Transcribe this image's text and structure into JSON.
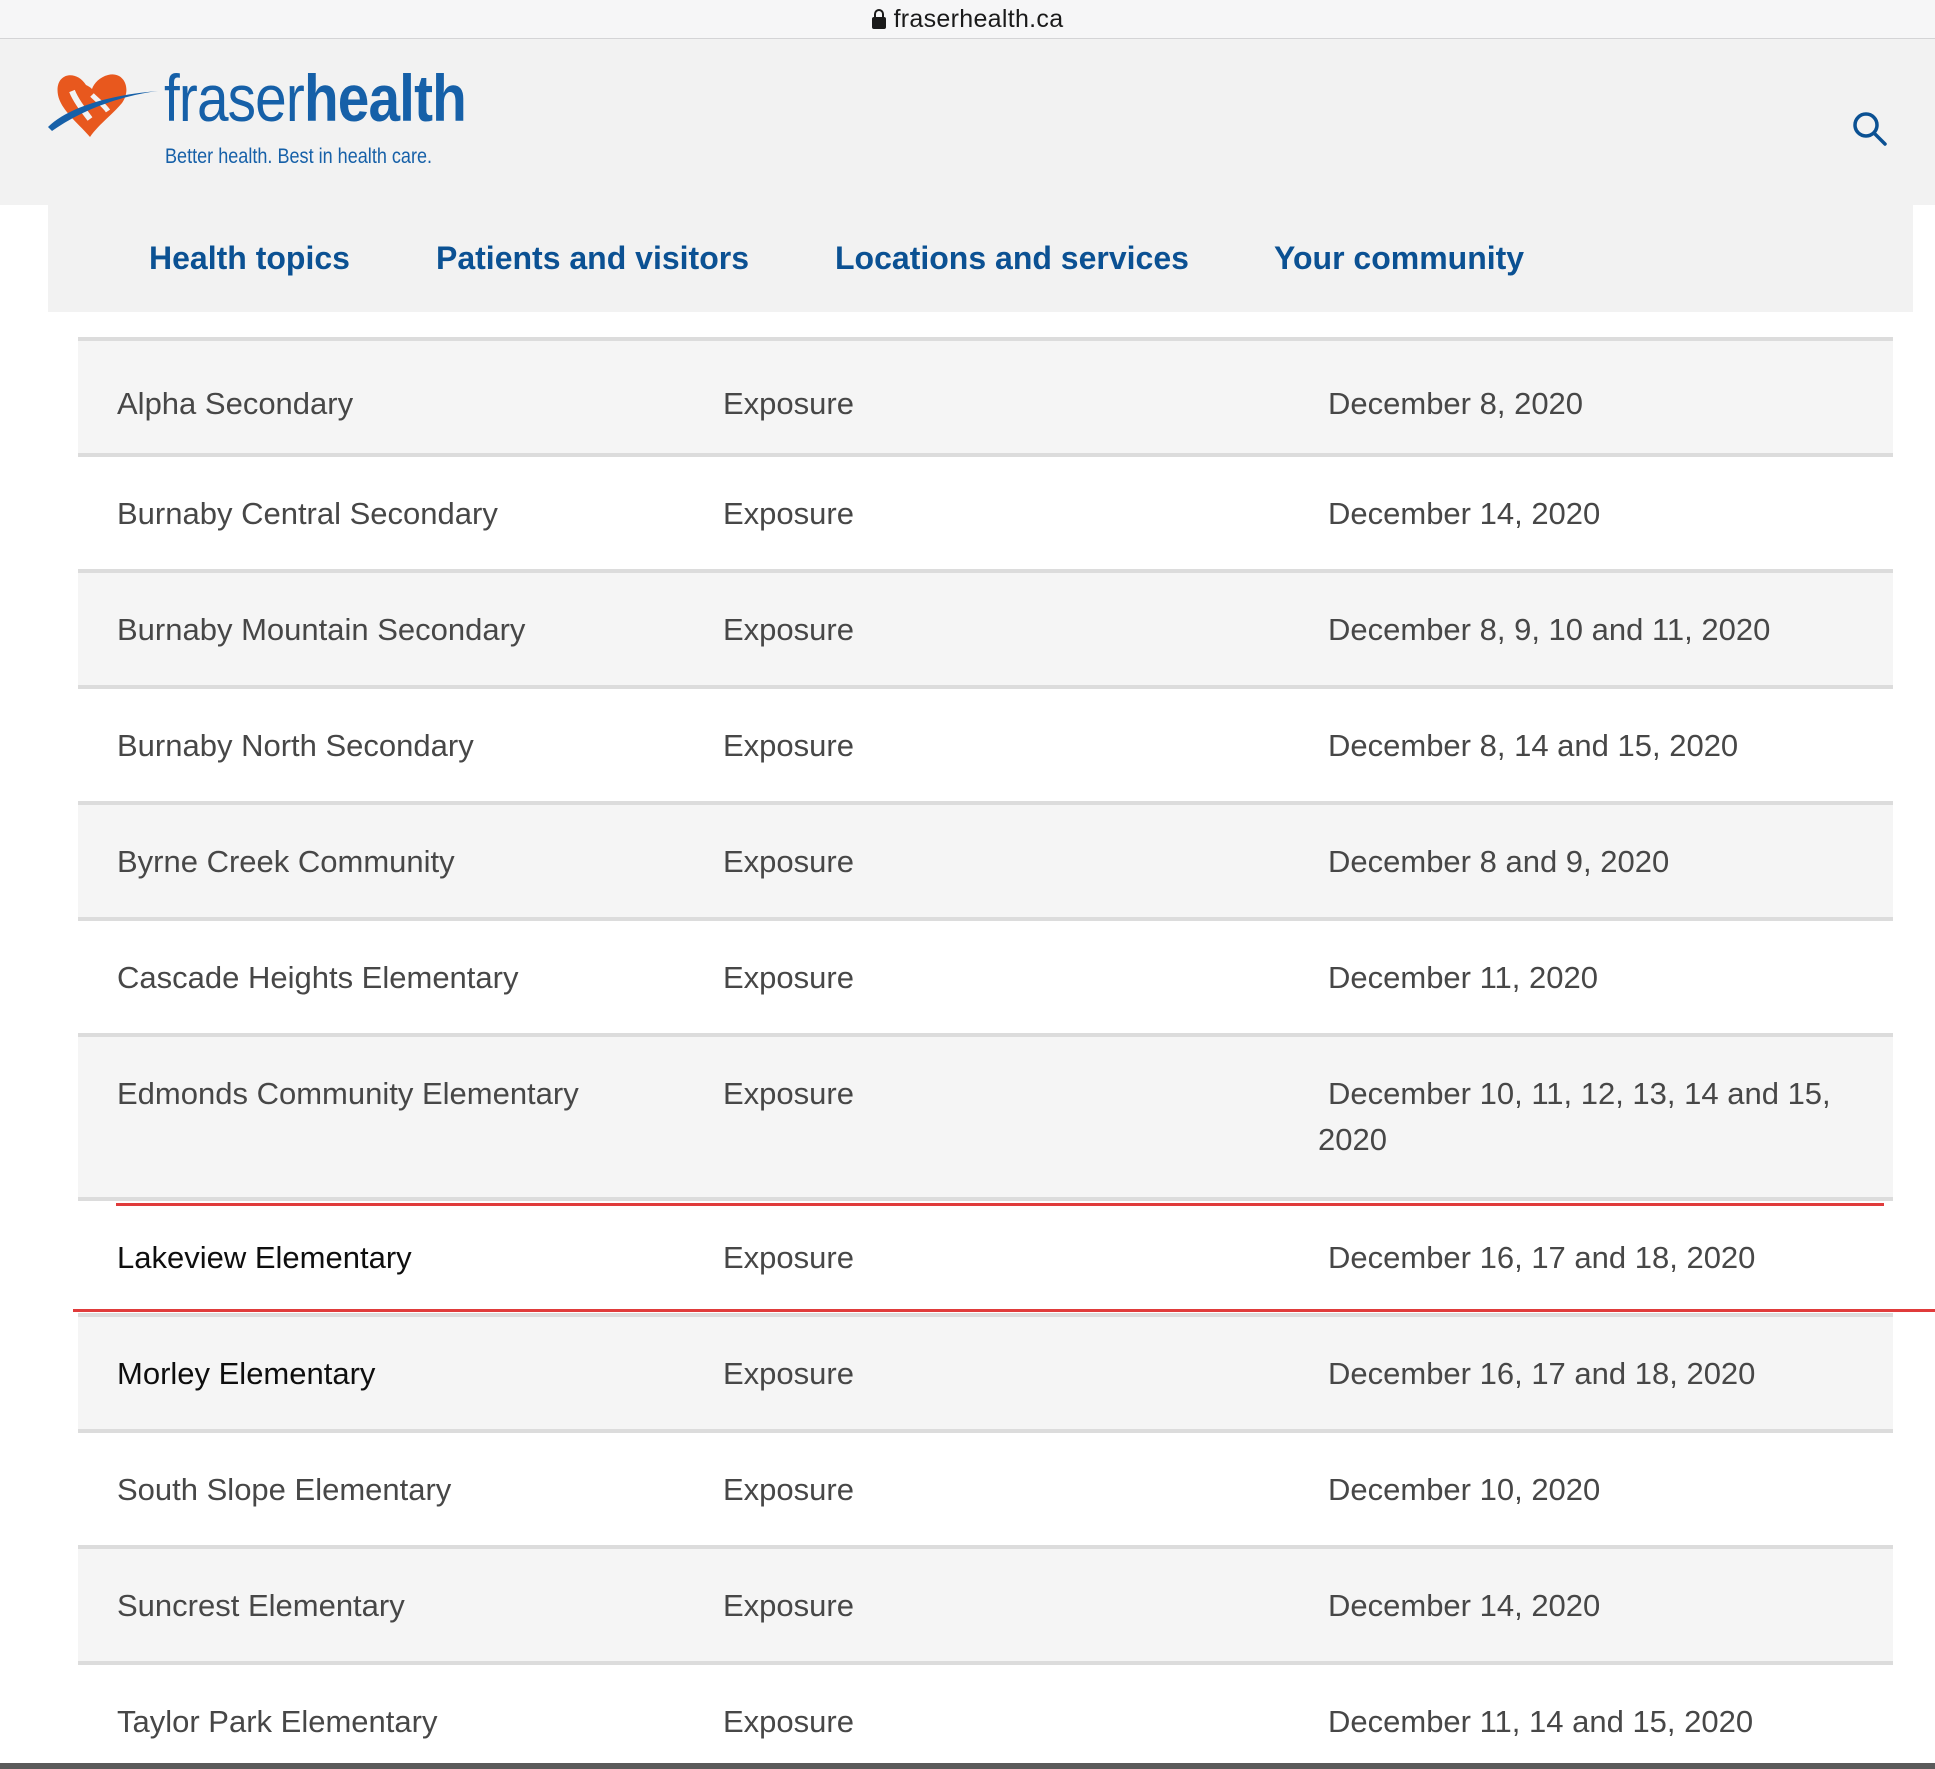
{
  "browser": {
    "url": "fraserhealth.ca"
  },
  "header": {
    "logo_word_regular": "fraser",
    "logo_word_bold": "health",
    "logo_tagline": "Better health. Best in health care.",
    "brand_colors": {
      "blue": "#1660a8",
      "orange": "#e8581e",
      "nav_blue": "#0b5193"
    },
    "search_icon": "search-icon"
  },
  "nav": {
    "items": [
      {
        "label": "Health topics"
      },
      {
        "label": "Patients and visitors"
      },
      {
        "label": "Locations and services"
      },
      {
        "label": "Your community"
      }
    ]
  },
  "table": {
    "rows": [
      {
        "school": "Alpha Secondary",
        "status": "Exposure",
        "dates": "December 8, 2020"
      },
      {
        "school": "Burnaby Central Secondary",
        "status": "Exposure",
        "dates": "December 14, 2020"
      },
      {
        "school": "Burnaby Mountain Secondary",
        "status": "Exposure",
        "dates": "December 8, 9, 10 and 11, 2020"
      },
      {
        "school": "Burnaby North Secondary",
        "status": "Exposure",
        "dates": "December 8, 14 and 15, 2020"
      },
      {
        "school": "Byrne Creek Community",
        "status": "Exposure",
        "dates": "December 8 and 9, 2020"
      },
      {
        "school": "Cascade Heights Elementary",
        "status": "Exposure",
        "dates": "December 11, 2020"
      },
      {
        "school": "Edmonds Community Elementary",
        "status": "Exposure",
        "dates": "December 10, 11, 12, 13, 14 and 15, 2020"
      },
      {
        "school": "Lakeview Elementary",
        "status": "Exposure",
        "dates": "December 16, 17 and 18, 2020"
      },
      {
        "school": "Morley Elementary",
        "status": "Exposure",
        "dates": "December 16, 17 and 18, 2020"
      },
      {
        "school": "South Slope Elementary",
        "status": "Exposure",
        "dates": "December 10, 2020"
      },
      {
        "school": "Suncrest Elementary",
        "status": "Exposure",
        "dates": "December 14, 2020"
      },
      {
        "school": "Taylor Park Elementary",
        "status": "Exposure",
        "dates": "December 11, 14 and 15, 2020"
      }
    ],
    "highlight_color": "#e03b3b"
  }
}
